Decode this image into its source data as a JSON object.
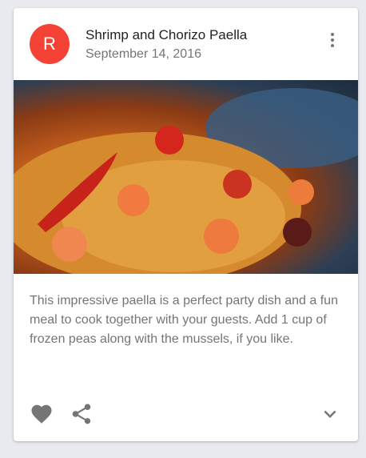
{
  "card": {
    "avatar_letter": "R",
    "title": "Shrimp and Chorizo Paella",
    "subheader": "September 14, 2016",
    "description": "This impressive paella is a perfect party dish and a fun meal to cook together with your guests. Add 1 cup of frozen peas along with the mussels, if you like.",
    "avatar_color": "#f44336"
  }
}
